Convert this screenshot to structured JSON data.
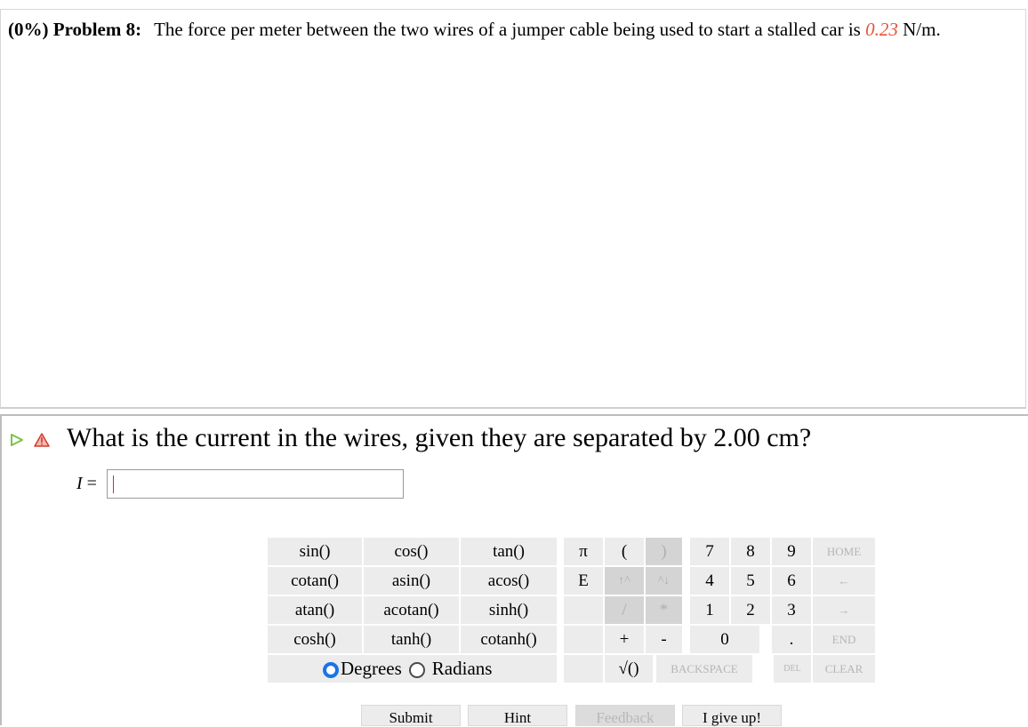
{
  "problem": {
    "percent": "(0%)",
    "number": "Problem 8:",
    "text_before": "The force per meter between the two wires of a jumper cable being used to start a stalled car is ",
    "value": "0.23",
    "text_after": " N/m."
  },
  "question": {
    "text": "What is the current in the wires, given they are separated by 2.00 cm?",
    "variable": "I",
    "equals": " = ",
    "answer_value": "",
    "answer_placeholder": ""
  },
  "keypad": {
    "functions": [
      [
        "sin()",
        "cos()",
        "tan()"
      ],
      [
        "cotan()",
        "asin()",
        "acos()"
      ],
      [
        "atan()",
        "acotan()",
        "sinh()"
      ],
      [
        "cosh()",
        "tanh()",
        "cotanh()"
      ]
    ],
    "pi": "π",
    "e": "E",
    "open_paren": "(",
    "close_paren": ")",
    "up_arrow": "↑^",
    "down_arrow": "^↓",
    "divide": "/",
    "multiply": "*",
    "plus": "+",
    "minus": "-",
    "sqrt": "√()",
    "digits": {
      "seven": "7",
      "eight": "8",
      "nine": "9",
      "four": "4",
      "five": "5",
      "six": "6",
      "one": "1",
      "two": "2",
      "three": "3",
      "zero": "0",
      "dot": "."
    },
    "home": "HOME",
    "left_arrow": "←",
    "right_arrow": "→",
    "end": "END",
    "backspace": "BACKSPACE",
    "del": "DEL",
    "clear": "CLEAR",
    "degrees": "Degrees",
    "radians": "Radians",
    "angle_mode": "Degrees"
  },
  "actions": {
    "submit": "Submit",
    "hint": "Hint",
    "feedback": "Feedback",
    "give_up": "I give up!"
  },
  "colors": {
    "value_highlight": "#e8523a",
    "radio_selected": "#1a73e8",
    "play_icon": "#7cc24a",
    "warning_icon": "#d43a2a"
  }
}
